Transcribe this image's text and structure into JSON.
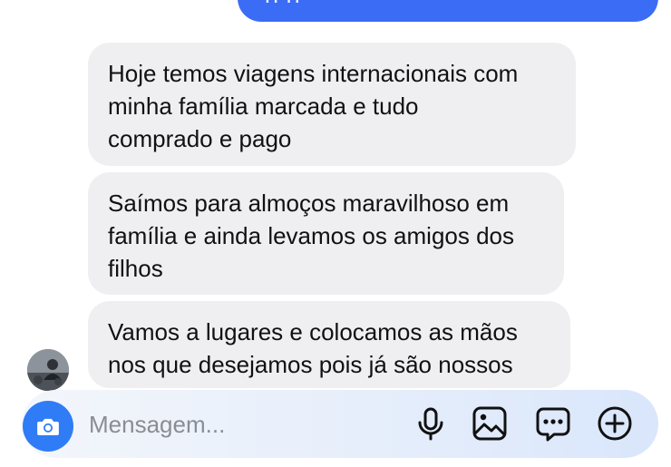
{
  "thread": {
    "sent_partial_text": "p        p",
    "messages": [
      {
        "lines": [
          "Hoje temos viagens internacionais com",
          "minha família marcada e tudo",
          "comprado e pago"
        ]
      },
      {
        "lines": [
          "Saímos para almoços maravilhoso em",
          "família e ainda levamos os amigos dos",
          "filhos"
        ]
      },
      {
        "lines": [
          "Vamos a lugares e colocamos as mãos",
          "nos que desejamos pois já são nossos"
        ]
      }
    ]
  },
  "composer": {
    "placeholder": "Mensagem...",
    "icons": [
      "camera-icon",
      "microphone-icon",
      "gallery-icon",
      "sticker-icon",
      "plus-icon"
    ]
  },
  "colors": {
    "sent_bubble": "#3b6cf6",
    "received_bubble": "#efeff1",
    "camera_button": "#2f7cf6"
  }
}
